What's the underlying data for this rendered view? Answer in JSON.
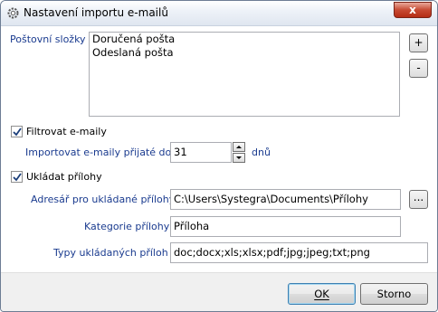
{
  "window": {
    "title": "Nastavení importu e-mailů",
    "close_label": "x"
  },
  "folders": {
    "label": "Poštovní složky",
    "items": [
      "Doručená pošta",
      "Odeslaná pošta"
    ],
    "add_label": "+",
    "remove_label": "-"
  },
  "filter": {
    "checkbox_label": "Filtrovat e-maily",
    "checked": true,
    "days_label": "Importovat e-maily přijaté do",
    "days_value": "31",
    "days_unit": "dnů"
  },
  "attachments": {
    "checkbox_label": "Ukládat přílohy",
    "checked": true,
    "dir_label": "Adresář pro ukládané přílohy",
    "dir_value": "C:\\Users\\Systegra\\Documents\\Přílohy",
    "browse_label": "...",
    "category_label": "Kategorie přílohy",
    "category_value": "Příloha",
    "types_label": "Typy ukládaných příloh",
    "types_value": "doc;docx;xls;xlsx;pdf;jpg;jpeg;txt;png"
  },
  "footer": {
    "ok_label": "OK",
    "cancel_label": "Storno"
  }
}
